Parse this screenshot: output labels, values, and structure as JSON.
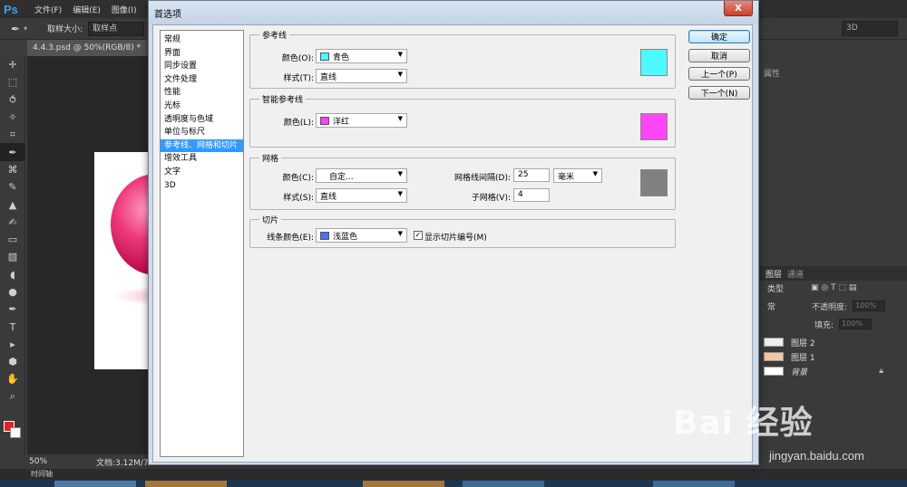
{
  "ps": {
    "logo": "Ps",
    "menu": [
      "文件(F)",
      "编辑(E)",
      "图像(I)"
    ],
    "options": {
      "sample_size_label": "取样大小:",
      "sample_value": "取样点"
    },
    "three_d": "3D",
    "doc_tab": "4.4.3.psd @ 50%(RGB/8) *",
    "zoom": "50%",
    "doc_info": "文档:3.12M/7",
    "timeline": "时间轴",
    "right_label": "属性",
    "layers_tabs": [
      "图层",
      "通道"
    ],
    "kind_label": "类型",
    "blend": "常",
    "opacity_label": "不透明度:",
    "opacity_value": "100%",
    "fill_label": "填充:",
    "fill_value": "100%",
    "layers": [
      "图层 2",
      "图层 1",
      "背景"
    ],
    "fg_color": "#e3211e",
    "bg_color": "#ffffff"
  },
  "dialog": {
    "title": "首选项",
    "close": "X",
    "nav_items": [
      "常规",
      "界面",
      "同步设置",
      "文件处理",
      "性能",
      "光标",
      "透明度与色域",
      "单位与标尺",
      "参考线、网格和切片",
      "增效工具",
      "文字",
      "3D"
    ],
    "selected_nav": "参考线、网格和切片",
    "guides": {
      "title": "参考线",
      "color_label": "颜色(O):",
      "color_value": "青色",
      "color_hex": "#4dfaff",
      "style_label": "样式(T):",
      "style_value": "直线"
    },
    "smart_guides": {
      "title": "智能参考线",
      "color_label": "颜色(L):",
      "color_value": "洋红",
      "color_hex": "#ff45f5"
    },
    "grid": {
      "title": "网格",
      "color_label": "颜色(C):",
      "color_value": "自定...",
      "color_hex": "#808080",
      "style_label": "样式(S):",
      "style_value": "直线",
      "gridline_label": "网格线间隔(D):",
      "gridline_value": "25",
      "unit": "毫米",
      "subdiv_label": "子网格(V):",
      "subdiv_value": "4"
    },
    "slices": {
      "title": "切片",
      "line_color_label": "线条颜色(E):",
      "line_color_value": "浅蓝色",
      "line_color_hex": "#4a74e8",
      "show_numbers_label": "显示切片编号(M)",
      "show_numbers_checked": true
    },
    "buttons": {
      "ok": "确定",
      "cancel": "取消",
      "prev": "上一个(P)",
      "next": "下一个(N)"
    }
  },
  "watermark": {
    "main": "Bai 经验",
    "sub": "jingyan.baidu.com"
  }
}
